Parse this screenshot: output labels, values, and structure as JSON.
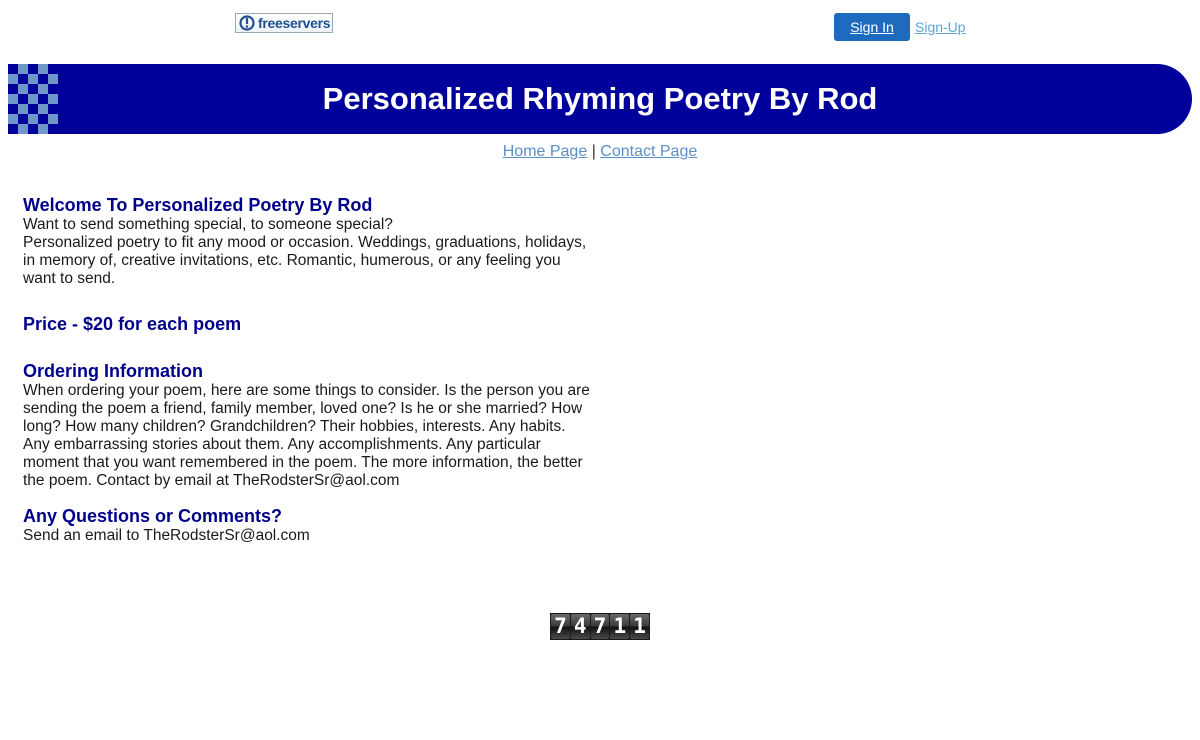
{
  "header": {
    "logo_text": "freeservers",
    "signin_label": "Sign In",
    "signup_label": "Sign-Up"
  },
  "banner": {
    "title": "Personalized Rhyming Poetry By Rod",
    "color": "#00009a"
  },
  "nav": {
    "home_label": "Home Page",
    "separator": "|",
    "contact_label": "Contact Page"
  },
  "content": {
    "welcome_heading": "Welcome To Personalized Poetry By Rod",
    "welcome_line1": "Want to send something special, to someone special?",
    "welcome_line2": "Personalized poetry to fit any mood or occasion. Weddings, graduations, holidays, in memory of, creative invitations, etc. Romantic, humerous, or any feeling you want to send.",
    "price_heading": "Price - $20 for each poem",
    "ordering_heading": "Ordering Information",
    "ordering_text": "When ordering your poem, here are some things to consider. Is the person you are sending the poem a friend, family member, loved one? Is he or she married? How long? How many children? Grandchildren? Their hobbies, interests. Any habits. Any embarrassing stories about them. Any accomplishments. Any particular moment that you want remembered in the poem. The more information, the better the poem. Contact by email at TheRodsterSr@aol.com",
    "questions_heading": "Any Questions or Comments?",
    "questions_text": "Send an email to TheRodsterSr@aol.com"
  },
  "counter": {
    "digits": [
      "7",
      "4",
      "7",
      "1",
      "1"
    ]
  },
  "colors": {
    "heading": "#00008b",
    "link": "#5b8fc7",
    "signin_bg": "#1c6bbf"
  }
}
